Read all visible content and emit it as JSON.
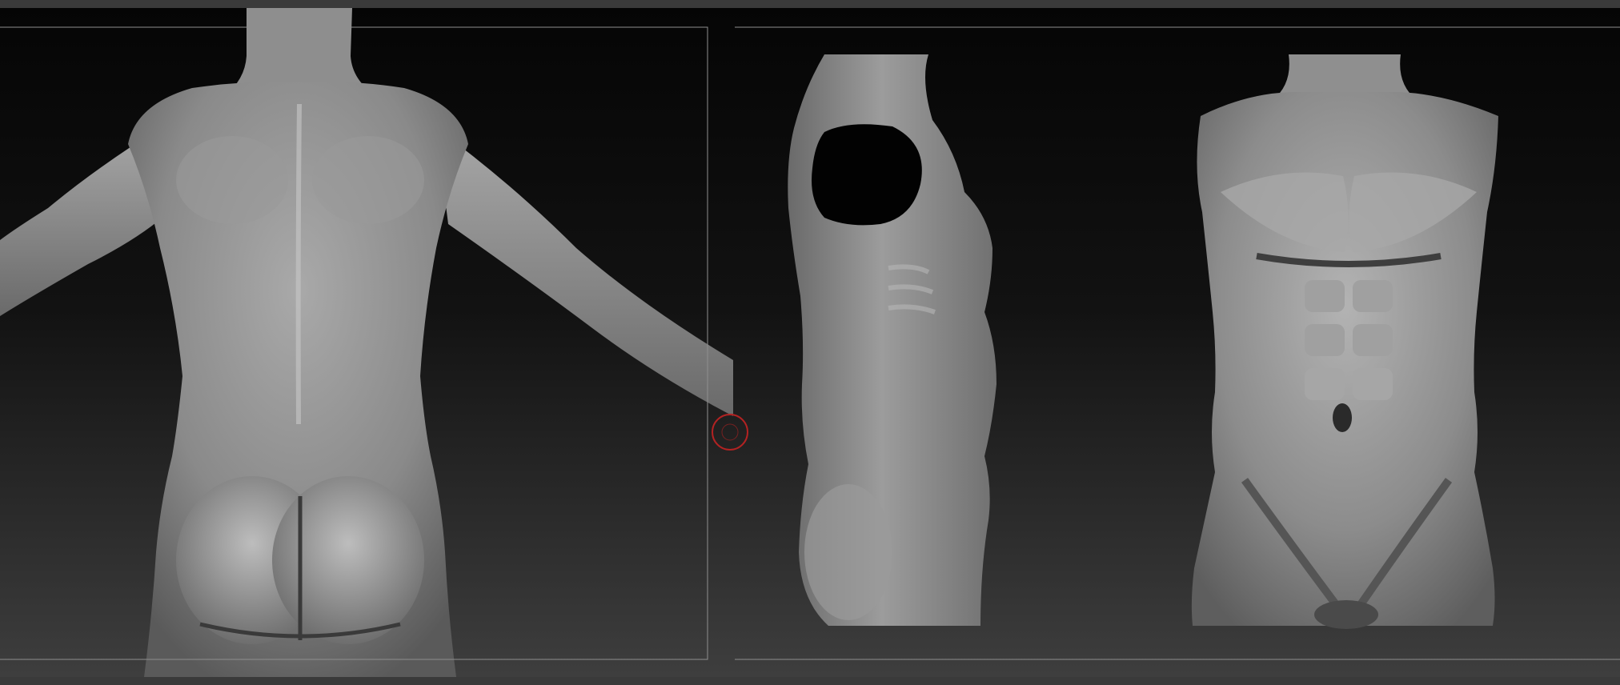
{
  "app": {
    "kind": "3D sculpting viewport",
    "views": [
      {
        "id": "back",
        "name": "back-view"
      },
      {
        "id": "side",
        "name": "side-view"
      },
      {
        "id": "front",
        "name": "front-view"
      }
    ]
  },
  "colors": {
    "bg_top": "#050505",
    "bg_bottom": "#3e3e3e",
    "mesh_light": "#b9b9b9",
    "mesh_mid": "#8a8a8a",
    "mesh_dark": "#3a3a3a",
    "frame_line": "#8f8f8f",
    "cursor_ring": "#b22222"
  },
  "icons": {
    "cursor": "brush-cursor-icon"
  }
}
